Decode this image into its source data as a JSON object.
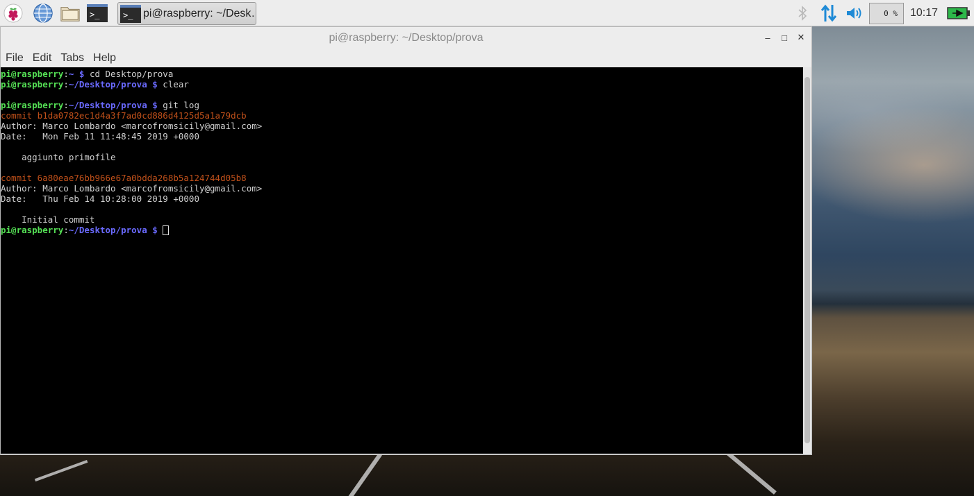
{
  "taskbar": {
    "launchers": [
      {
        "name": "raspberry-menu-icon"
      },
      {
        "name": "web-browser-icon"
      },
      {
        "name": "file-manager-icon"
      },
      {
        "name": "terminal-launcher-icon"
      }
    ],
    "active_task_label": "pi@raspberry: ~/Desk…",
    "cpu_value": "0 %",
    "clock": "10:17",
    "tray_icons": [
      "bluetooth-icon",
      "network-icon",
      "volume-icon",
      "battery-icon"
    ]
  },
  "window": {
    "title": "pi@raspberry: ~/Desktop/prova",
    "menu": [
      "File",
      "Edit",
      "Tabs",
      "Help"
    ],
    "controls": {
      "minimize": "–",
      "maximize": "□",
      "close": "✕"
    }
  },
  "terminal": {
    "lines": [
      {
        "segments": [
          {
            "t": "pi@raspberry",
            "c": "pu"
          },
          {
            "t": ":",
            "c": ""
          },
          {
            "t": "~ $",
            "c": "pp"
          },
          {
            "t": " cd Desktop/prova",
            "c": ""
          }
        ]
      },
      {
        "segments": [
          {
            "t": "pi@raspberry",
            "c": "pu"
          },
          {
            "t": ":",
            "c": ""
          },
          {
            "t": "~/Desktop/prova $",
            "c": "pp"
          },
          {
            "t": " clear",
            "c": ""
          }
        ]
      },
      {
        "segments": []
      },
      {
        "segments": [
          {
            "t": "pi@raspberry",
            "c": "pu"
          },
          {
            "t": ":",
            "c": ""
          },
          {
            "t": "~/Desktop/prova $",
            "c": "pp"
          },
          {
            "t": " git log",
            "c": ""
          }
        ]
      },
      {
        "segments": [
          {
            "t": "commit b1da0782ec1d4a3f7ad0cd886d4125d5a1a79dcb",
            "c": "hash"
          }
        ]
      },
      {
        "segments": [
          {
            "t": "Author: Marco Lombardo <marcofromsicily@gmail.com>",
            "c": ""
          }
        ]
      },
      {
        "segments": [
          {
            "t": "Date:   Mon Feb 11 11:48:45 2019 +0000",
            "c": ""
          }
        ]
      },
      {
        "segments": []
      },
      {
        "segments": [
          {
            "t": "    aggiunto primofile",
            "c": ""
          }
        ]
      },
      {
        "segments": []
      },
      {
        "segments": [
          {
            "t": "commit 6a80eae76bb966e67a0bdda268b5a124744d05b8",
            "c": "hash"
          }
        ]
      },
      {
        "segments": [
          {
            "t": "Author: Marco Lombardo <marcofromsicily@gmail.com>",
            "c": ""
          }
        ]
      },
      {
        "segments": [
          {
            "t": "Date:   Thu Feb 14 10:28:00 2019 +0000",
            "c": ""
          }
        ]
      },
      {
        "segments": []
      },
      {
        "segments": [
          {
            "t": "    Initial commit",
            "c": ""
          }
        ]
      },
      {
        "segments": [
          {
            "t": "pi@raspberry",
            "c": "pu"
          },
          {
            "t": ":",
            "c": ""
          },
          {
            "t": "~/Desktop/prova $",
            "c": "pp"
          },
          {
            "t": " ",
            "c": ""
          }
        ],
        "cursor": true
      }
    ]
  },
  "colors": {
    "prompt_user": "#55e055",
    "prompt_path": "#6a6aff",
    "commit_hash": "#c0501a",
    "terminal_bg": "#000000",
    "terminal_fg": "#d0d0d0"
  }
}
